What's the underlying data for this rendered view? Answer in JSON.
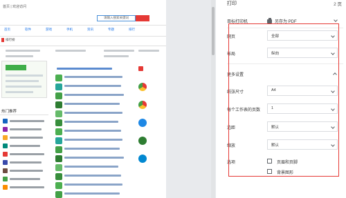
{
  "preview": {
    "site_nav": [
      "首页",
      "软件",
      "游戏",
      "手机",
      "资讯",
      "专题",
      "排行"
    ],
    "top_text": "首页 | 欢迎访问",
    "search_placeholder": "请输入搜索关键词",
    "section_label": "排行榜",
    "left_label": "热门推荐"
  },
  "settings": {
    "title": "打印",
    "page_count": "2 页",
    "destination": {
      "label": "目标打印机",
      "value": "另存为 PDF"
    },
    "pages": {
      "label": "网页",
      "value": "全部"
    },
    "layout": {
      "label": "布局",
      "value": "纵向"
    },
    "more_settings": {
      "label": "更多设置"
    },
    "paper_size": {
      "label": "纸张尺寸",
      "value": "A4"
    },
    "pages_per_sheet": {
      "label": "每个工作表的页数",
      "value": "1"
    },
    "margins": {
      "label": "边距",
      "value": "默认"
    },
    "scale": {
      "label": "缩放",
      "value": "默认"
    },
    "options": {
      "label": "选项",
      "headers_footers": "页眉和页脚",
      "background_graphics": "背景图形"
    },
    "colors": {
      "highlight": "#e53935",
      "accent": "#1a73e8"
    }
  }
}
